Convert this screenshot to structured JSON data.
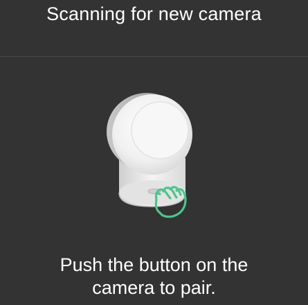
{
  "header": {
    "title": "Scanning for new camera"
  },
  "illustration": {
    "camera_icon": "baby-monitor-camera-icon",
    "hand_icon": "pointing-hand-icon",
    "hand_color": "#4cc58a",
    "camera_color": "#f2f2f2"
  },
  "instruction": {
    "line1": "Push the button on the",
    "line2": "camera to pair."
  },
  "colors": {
    "background": "#333333",
    "divider": "#4a4a4a",
    "text": "#ffffff",
    "accent": "#4cc58a"
  }
}
